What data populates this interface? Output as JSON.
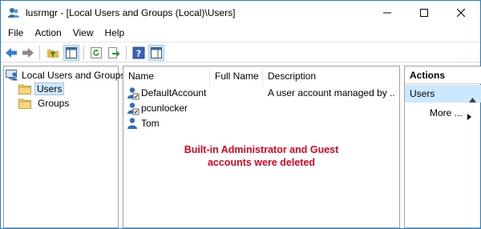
{
  "window": {
    "title": "lusrmgr - [Local Users and Groups (Local)\\Users]",
    "accent_color": "#1883d7"
  },
  "menu": {
    "items": [
      "File",
      "Action",
      "View",
      "Help"
    ]
  },
  "toolbar": {
    "buttons": [
      "back-arrow-icon",
      "forward-arrow-icon",
      "up-folder-icon",
      "show-hide-console-tree-icon",
      "refresh-icon",
      "export-list-icon",
      "help-icon",
      "show-hide-action-pane-icon"
    ]
  },
  "tree": {
    "root": "Local Users and Groups",
    "items": [
      {
        "label": "Users",
        "selected": true
      },
      {
        "label": "Groups",
        "selected": false
      }
    ]
  },
  "list": {
    "columns": [
      "Name",
      "Full Name",
      "Description"
    ],
    "rows": [
      {
        "name": "DefaultAccount",
        "full_name": "",
        "description": "A user account managed by ..."
      },
      {
        "name": "pcunlocker",
        "full_name": "",
        "description": ""
      },
      {
        "name": "Tom",
        "full_name": "",
        "description": ""
      }
    ],
    "note_line1": "Built-in Administrator and Guest",
    "note_line2": "accounts were deleted",
    "note_color": "#e6001e"
  },
  "actions": {
    "header": "Actions",
    "group": "Users",
    "items": [
      "More ..."
    ]
  }
}
